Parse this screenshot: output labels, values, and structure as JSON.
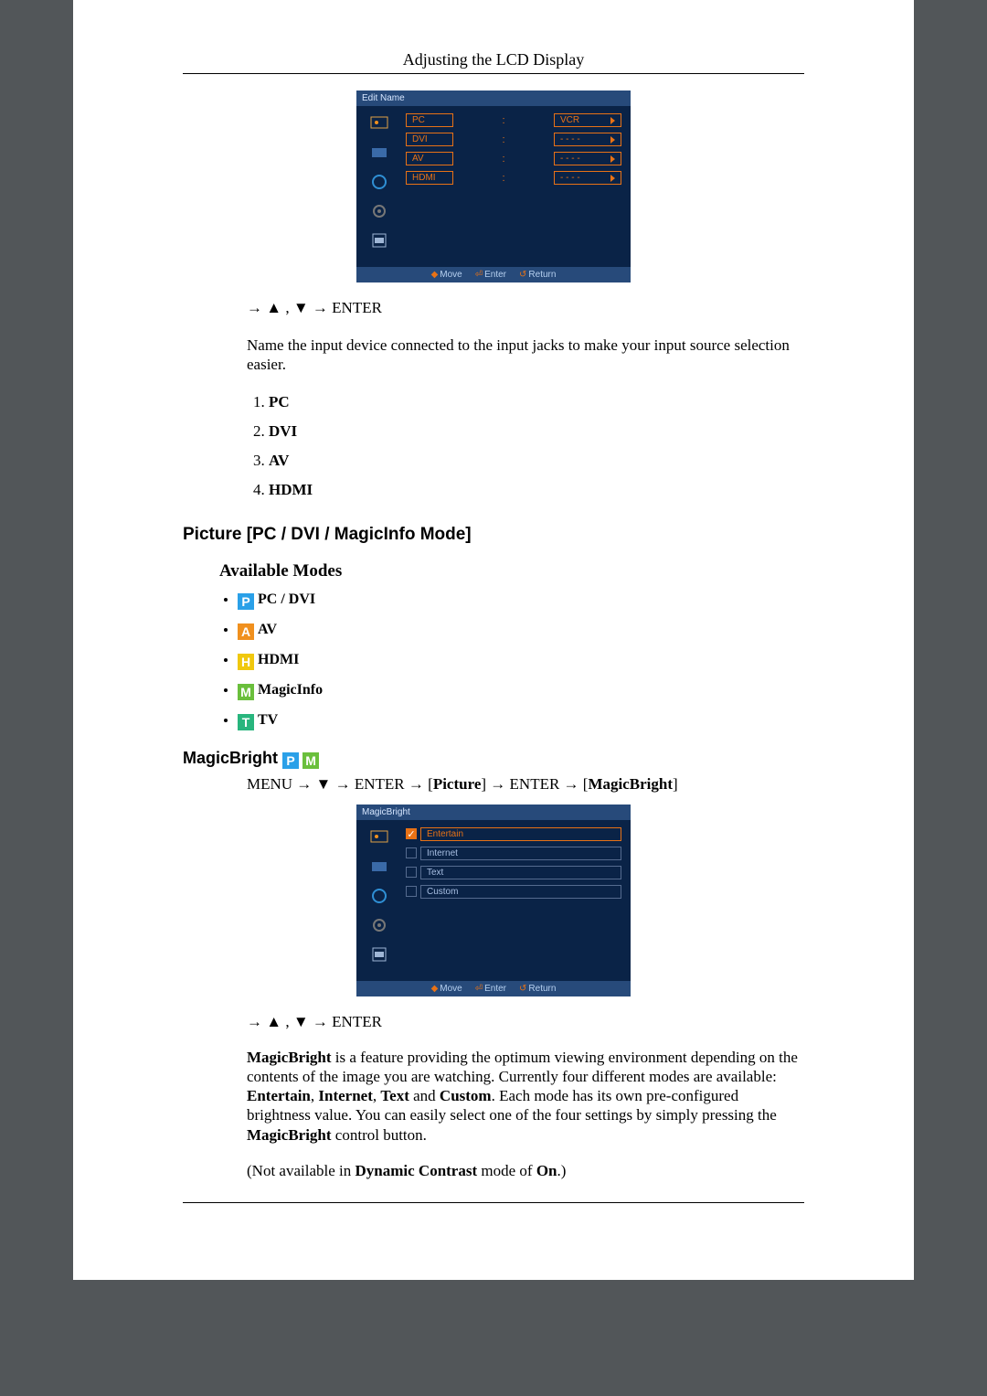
{
  "header": {
    "title": "Adjusting the LCD Display"
  },
  "osd1": {
    "title": "Edit Name",
    "rows": [
      {
        "label": "PC",
        "value": "VCR"
      },
      {
        "label": "DVI",
        "value": "- - - -"
      },
      {
        "label": "AV",
        "value": "- - - -"
      },
      {
        "label": "HDMI",
        "value": "- - - -"
      }
    ],
    "footer": {
      "move": "Move",
      "enter": "Enter",
      "return": "Return"
    }
  },
  "nav1": "→ ▲ , ▼ → ENTER",
  "desc1": "Name the input device connected to the input jacks to make your input source selection easier.",
  "sources": [
    "PC",
    "DVI",
    "AV",
    "HDMI"
  ],
  "section_picture_title": "Picture [PC / DVI / MagicInfo Mode]",
  "available_modes_title": "Available Modes",
  "modes": [
    {
      "badge_letter": "P",
      "badge_class": "b-P",
      "name": "PC / DVI"
    },
    {
      "badge_letter": "A",
      "badge_class": "b-A",
      "name": "AV"
    },
    {
      "badge_letter": "H",
      "badge_class": "b-H",
      "name": "HDMI"
    },
    {
      "badge_letter": "M",
      "badge_class": "b-M",
      "name": "MagicInfo"
    },
    {
      "badge_letter": "T",
      "badge_class": "b-T",
      "name": "TV"
    }
  ],
  "magicbright_title": "MagicBright",
  "menu_path": {
    "p1": "MENU → ▼ → ENTER → [",
    "picture": "Picture",
    "p2": "] → ENTER → [",
    "mb": "MagicBright",
    "p3": "]"
  },
  "osd2": {
    "title": "MagicBright",
    "rows": [
      {
        "label": "Entertain",
        "active": true
      },
      {
        "label": "Internet",
        "active": false
      },
      {
        "label": "Text",
        "active": false
      },
      {
        "label": "Custom",
        "active": false
      }
    ],
    "footer": {
      "move": "Move",
      "enter": "Enter",
      "return": "Return"
    }
  },
  "nav2": "→ ▲ , ▼ → ENTER",
  "mb_para": {
    "lead_bold": "MagicBright",
    "t1": " is a feature providing the optimum viewing environment depending on the contents of the image you are watching. Currently four different modes are available: ",
    "m1": "Entertain",
    "c1": ", ",
    "m2": "Internet",
    "c2": ", ",
    "m3": "Text",
    "t2": " and ",
    "m4": "Custom",
    "t3": ". Each mode has its own pre-configured brightness value. You can easily select one of the four settings by simply pressing the ",
    "ctrl": "MagicBright",
    "t4": " control button."
  },
  "not_available": {
    "p1": "(Not available in ",
    "b1": "Dynamic Contrast",
    "p2": " mode of ",
    "b2": "On",
    "p3": ".)"
  }
}
